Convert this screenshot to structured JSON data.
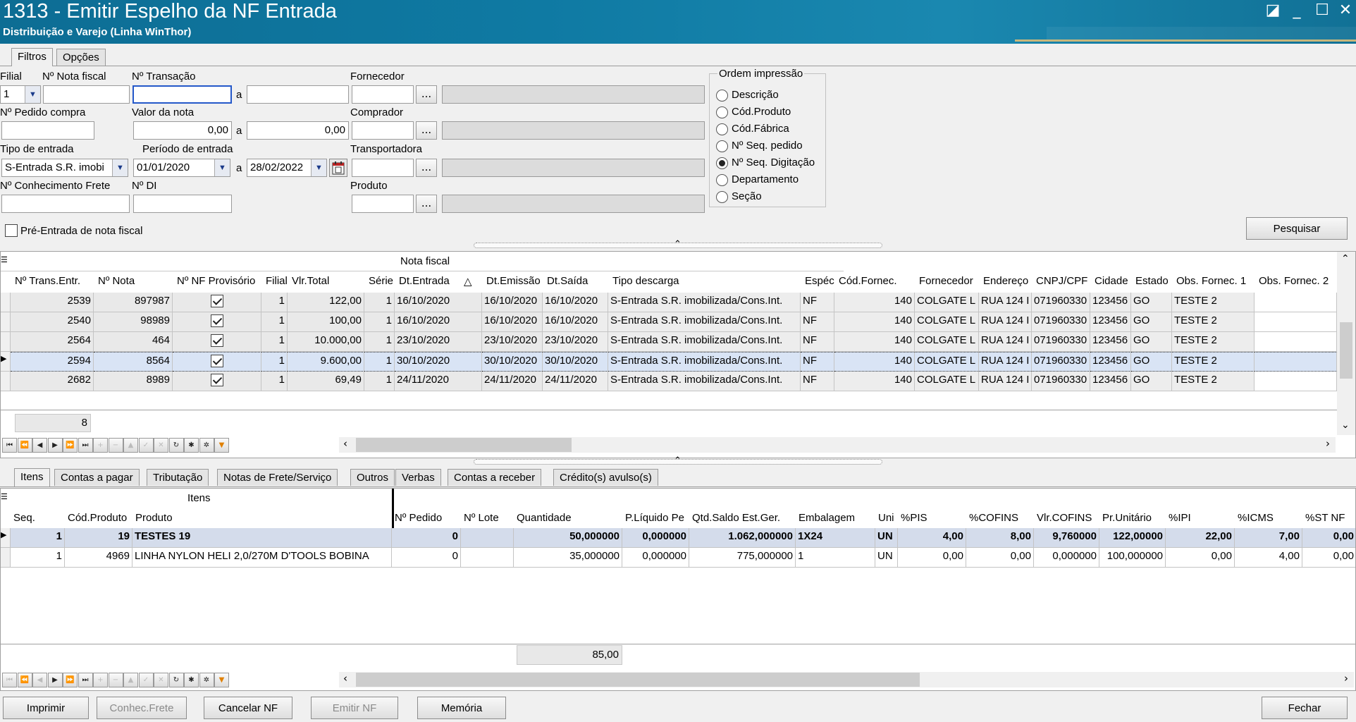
{
  "window": {
    "title": "1313 - Emitir Espelho da NF Entrada",
    "subtitle": "Distribuição e Varejo (Linha WinThor)",
    "minimize": "_",
    "maximize": "☐",
    "close": "✕",
    "restore": "◪"
  },
  "tabs": [
    "Filtros",
    "Opções"
  ],
  "filters": {
    "filial_label": "Filial",
    "filial_value": "1",
    "nota_fiscal_label": "Nº Nota fiscal",
    "transacao_label": "Nº Transação",
    "a": "a",
    "fornecedor_label": "Fornecedor",
    "pedido_compra_label": "Nº Pedido compra",
    "valor_nota_label": "Valor da nota",
    "valor_de": "0,00",
    "valor_ate": "0,00",
    "comprador_label": "Comprador",
    "tipo_entrada_label": "Tipo de entrada",
    "tipo_entrada_value": "S-Entrada S.R. imobi",
    "periodo_label": "Período de entrada",
    "periodo_de": "01/01/2020",
    "periodo_ate": "28/02/2022",
    "transportadora_label": "Transportadora",
    "conhecimento_label": "Nº Conhecimento Frete",
    "di_label": "Nº DI",
    "produto_label": "Produto",
    "pre_entrada_label": "Pré-Entrada de nota fiscal",
    "ellipsis": "...",
    "pesquisar": "Pesquisar"
  },
  "ordem": {
    "title": "Ordem impressão",
    "options": [
      "Descrição",
      "Cód.Produto",
      "Cód.Fábrica",
      "Nº Seq. pedido",
      "Nº Seq. Digitação",
      "Departamento",
      "Seção"
    ],
    "selected": "Nº Seq. Digitação"
  },
  "nf_grid": {
    "band": "Nota fiscal",
    "columns": [
      "Nº Trans.Entr.",
      "Nº Nota",
      "Nº NF Provisório",
      "Filial",
      "Vlr.Total",
      "Série",
      "Dt.Entrada",
      "Dt.Emissão",
      "Dt.Saída",
      "Tipo descarga",
      "Espécie",
      "Cód.Fornec.",
      "Fornecedor",
      "Endereço",
      "CNPJ/CPF",
      "Cidade",
      "Estado",
      "Obs. Fornec. 1",
      "Obs. Fornec. 2"
    ],
    "rows": [
      [
        "2539",
        "897987",
        "✓",
        "1",
        "122,00",
        "1",
        "16/10/2020",
        "16/10/2020",
        "16/10/2020",
        "S-Entrada S.R. imobilizada/Cons.Int.",
        "NF",
        "140",
        "COLGATE L",
        "RUA 124 I",
        "071960330",
        "123456",
        "GO",
        "TESTE 2",
        ""
      ],
      [
        "2540",
        "98989",
        "✓",
        "1",
        "100,00",
        "1",
        "16/10/2020",
        "16/10/2020",
        "16/10/2020",
        "S-Entrada S.R. imobilizada/Cons.Int.",
        "NF",
        "140",
        "COLGATE L",
        "RUA 124 I",
        "071960330",
        "123456",
        "GO",
        "TESTE 2",
        ""
      ],
      [
        "2564",
        "464",
        "✓",
        "1",
        "10.000,00",
        "1",
        "23/10/2020",
        "23/10/2020",
        "23/10/2020",
        "S-Entrada S.R. imobilizada/Cons.Int.",
        "NF",
        "140",
        "COLGATE L",
        "RUA 124 I",
        "071960330",
        "123456",
        "GO",
        "TESTE 2",
        ""
      ],
      [
        "2594",
        "8564",
        "✓",
        "1",
        "9.600,00",
        "1",
        "30/10/2020",
        "30/10/2020",
        "30/10/2020",
        "S-Entrada S.R. imobilizada/Cons.Int.",
        "NF",
        "140",
        "COLGATE L",
        "RUA 124 I",
        "071960330",
        "123456",
        "GO",
        "TESTE 2",
        ""
      ],
      [
        "2682",
        "8989",
        "✓",
        "1",
        "69,49",
        "1",
        "24/11/2020",
        "24/11/2020",
        "24/11/2020",
        "S-Entrada S.R. imobilizada/Cons.Int.",
        "NF",
        "140",
        "COLGATE L",
        "RUA 124 I",
        "071960330",
        "123456",
        "GO",
        "TESTE 2",
        ""
      ]
    ],
    "selected_row": 3,
    "sort_indicator": "△",
    "footer_count": "8"
  },
  "bottom_tabs": [
    "Itens",
    "Contas a pagar",
    "Tributação",
    "Notas de Frete/Serviço",
    "Outros",
    "Verbas",
    "Contas a receber",
    "Crédito(s) avulso(s)"
  ],
  "items_grid": {
    "band": "Itens",
    "columns": [
      "Seq.",
      "Cód.Produto",
      "Produto",
      "Nº Pedido",
      "Nº Lote",
      "Quantidade",
      "P.Líquido Pe",
      "Qtd.Saldo Est.Ger.",
      "Embalagem",
      "Uni",
      "%PIS",
      "%COFINS",
      "Vlr.COFINS",
      "Pr.Unitário",
      "%IPI",
      "%ICMS",
      "%ST NF"
    ],
    "rows": [
      [
        "1",
        "19",
        "TESTES 19",
        "0",
        "",
        "50,000000",
        "0,000000",
        "1.062,000000",
        "1X24",
        "UN",
        "4,00",
        "8,00",
        "9,760000",
        "122,00000",
        "22,00",
        "7,00",
        "0,00"
      ],
      [
        "1",
        "4969",
        "LINHA NYLON HELI 2,0/270M D'TOOLS BOBINA",
        "0",
        "",
        "35,000000",
        "0,000000",
        "775,000000",
        "1",
        "UN",
        "0,00",
        "0,00",
        "0,000000",
        "100,000000",
        "0,00",
        "4,00",
        "0,00"
      ]
    ],
    "footer_total": "85,00"
  },
  "bottom_buttons": {
    "imprimir": "Imprimir",
    "conhec_frete": "Conhec.Frete",
    "cancelar_nf": "Cancelar NF",
    "emitir_nf": "Emitir NF",
    "memoria": "Memória",
    "fechar": "Fechar"
  },
  "nav_icons": [
    "first-icon",
    "prev-page-icon",
    "prev-icon",
    "next-icon",
    "next-page-icon",
    "last-icon",
    "insert-icon",
    "delete-icon",
    "edit-icon",
    "post-icon",
    "cancel-icon",
    "refresh-icon",
    "bookmark-icon",
    "goto-bookmark-icon",
    "filter-icon"
  ]
}
